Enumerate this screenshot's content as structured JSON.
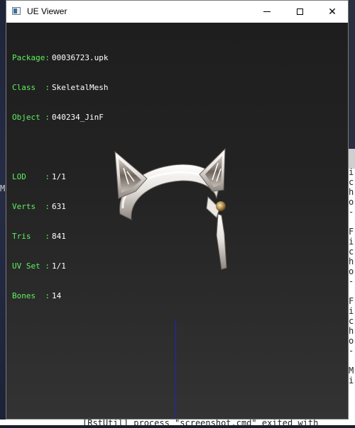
{
  "window": {
    "title": "UE Viewer",
    "controls": {
      "minimize": "minimize",
      "maximize": "maximize",
      "close": "✕"
    }
  },
  "info": {
    "package_label": "Package:",
    "package_value": "00036723.upk",
    "class_label": "Class  :",
    "class_value": "SkeletalMesh",
    "object_label": "Object :",
    "object_value": "040234_JinF",
    "lod_label": "LOD    :",
    "lod_value": "1/1",
    "verts_label": "Verts  :",
    "verts_value": "631",
    "tris_label": "Tris   :",
    "tris_value": "841",
    "uvset_label": "UV Set :",
    "uvset_value": "1/1",
    "bones_label": "Bones  :",
    "bones_value": "14"
  },
  "background": {
    "left_char": "M",
    "right_chars": "i\nc\nh\no\n-\n \nF\ni\nc\nh\no\n-\n \nF\ni\nc\nh\no\n-\n \nM\ni",
    "bottom_text": "[RstUtil] process \"screenshot.cmd\" exited with"
  },
  "colors": {
    "label_green": "#5ff05f",
    "value_white": "#ffffff",
    "axis_blue": "#2020d8"
  }
}
